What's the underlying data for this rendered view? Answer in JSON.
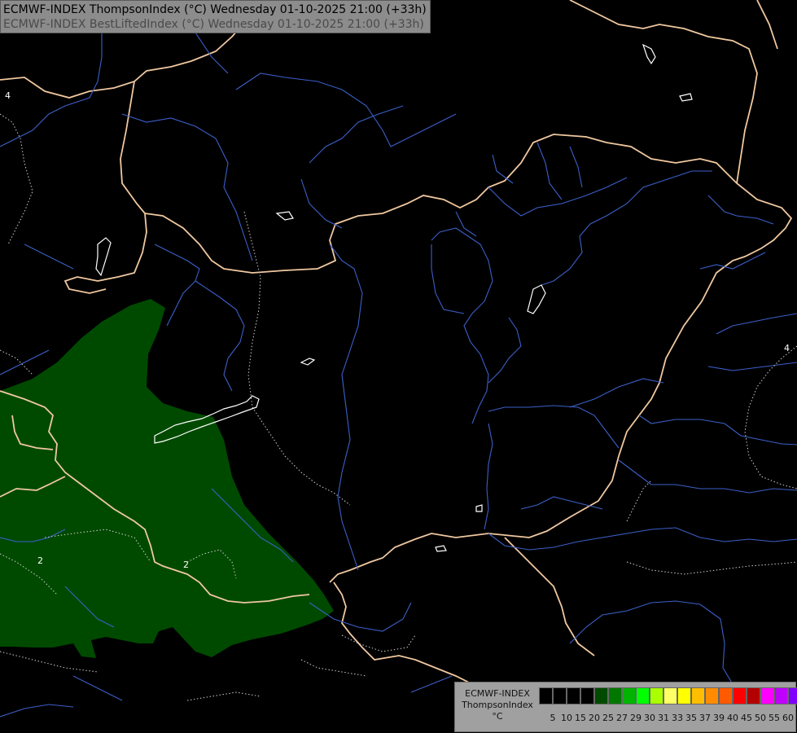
{
  "header": {
    "line1": "ECMWF-INDEX ThompsonIndex (°C) Wednesday 01-10-2025 21:00 (+33h)",
    "line2": "ECMWF-INDEX BestLiftedIndex (°C) Wednesday 01-10-2025 21:00 (+33h)"
  },
  "legend": {
    "line1": "ECMWF-INDEX",
    "line2": "ThompsonIndex",
    "line3": "°C",
    "colors": [
      "#000000",
      "#000000",
      "#000000",
      "#000000",
      "#004a00",
      "#007800",
      "#00b400",
      "#00ff00",
      "#aaff00",
      "#ffff66",
      "#ffff00",
      "#ffbf00",
      "#ff8c00",
      "#ff5a00",
      "#ff0000",
      "#b40000",
      "#ff00ff",
      "#bf00ff",
      "#7f00ff",
      "#3f00ff",
      "#0000ff"
    ],
    "ticks": [
      "5",
      "10",
      "15",
      "20",
      "25",
      "27",
      "29",
      "30",
      "31",
      "33",
      "35",
      "37",
      "39",
      "40",
      "45",
      "50",
      "55",
      "60"
    ]
  },
  "contour_labels": [
    "4",
    "4",
    "2",
    "2"
  ],
  "colors": {
    "background": "#000000",
    "border": "#f0c8a0",
    "rivers": "#3c5fc8",
    "fill_level": "#004a00",
    "lakes": "#ffffff"
  }
}
